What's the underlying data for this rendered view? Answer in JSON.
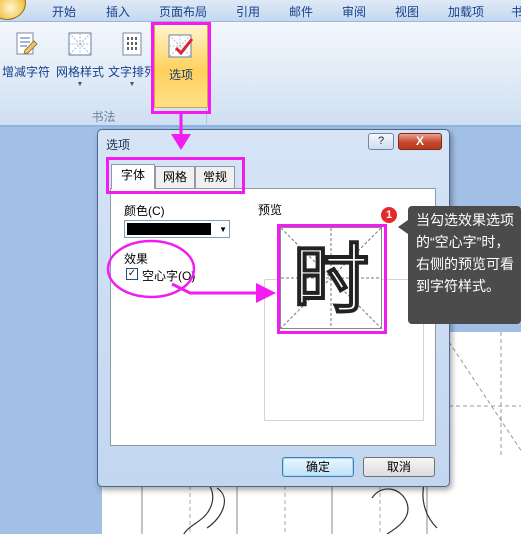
{
  "ribbon": {
    "tabs": [
      "开始",
      "插入",
      "页面布局",
      "引用",
      "邮件",
      "审阅",
      "视图",
      "加载项",
      "书"
    ],
    "group_label": "书法",
    "buttons": {
      "add_remove": "增减字符",
      "grid_style": "网格样式",
      "text_arrange": "文字排列",
      "options": "选项"
    }
  },
  "dialog": {
    "title": "选项",
    "help": "?",
    "close": "X",
    "tabs": [
      "字体",
      "网格",
      "常规"
    ],
    "font_tab": {
      "color_label": "颜色(C)",
      "color_value": "#000000",
      "effects_label": "效果",
      "hollow_label": "空心字(O)",
      "hollow_checked": true,
      "preview_label": "预览"
    },
    "ok_label": "确定",
    "cancel_label": "取消"
  },
  "preview_char": "时",
  "callout": {
    "badge": "1",
    "text": "当勾选效果选项的“空心字”时，右侧的预览可看到字符样式。"
  },
  "highlight_color": "#f21cf0"
}
